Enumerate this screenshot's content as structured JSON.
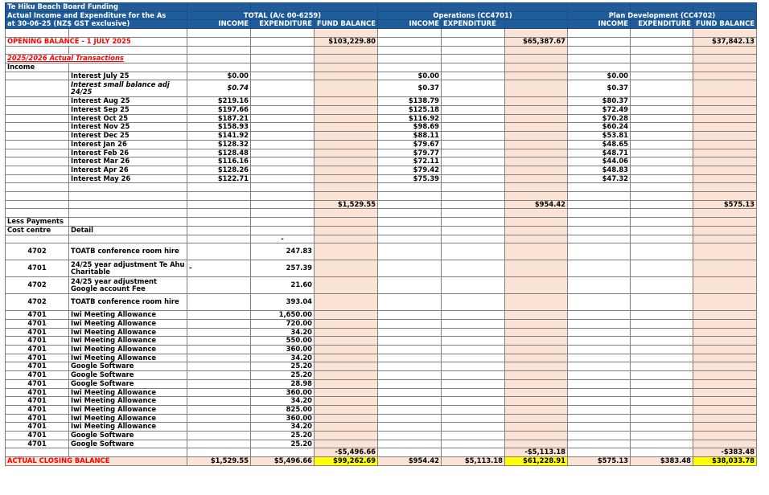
{
  "title": "Te Hiku Beach Board Funding",
  "header": {
    "line1": "Actual Income and Expenditure for the As",
    "line2": "at 30-06-25  (NZ$ GST exclusive)",
    "groups": [
      "TOTAL  (A/c 00-6259)",
      "Operations (CC4701)",
      "Plan Development (CC4702)"
    ],
    "cols": [
      "INCOME",
      "EXPENDITURE",
      "FUND BALANCE"
    ]
  },
  "opening": {
    "label": "OPENING BALANCE - 1 JULY 2025",
    "total": "$103,229.80",
    "ops": "$65,387.67",
    "plan": "$37,842.13"
  },
  "actual_label": "2025/2026 Actual Transactions",
  "income_label": "Income",
  "interest": [
    {
      "label": "Interest July 25",
      "total": "$0.00",
      "ops": "$0.00",
      "plan": "$0.00"
    },
    {
      "label": "Interest small balance adj 24/25",
      "total": "$0.74",
      "ops": "$0.37",
      "plan": "$0.37"
    },
    {
      "label": "Interest Aug 25",
      "total": "$219.16",
      "ops": "$138.79",
      "plan": "$80.37"
    },
    {
      "label": "Interest Sep 25",
      "total": "$197.66",
      "ops": "$125.18",
      "plan": "$72.49"
    },
    {
      "label": "Interest Oct 25",
      "total": "$187.21",
      "ops": "$116.92",
      "plan": "$70.28"
    },
    {
      "label": "Interest Nov 25",
      "total": "$158.93",
      "ops": "$98.69",
      "plan": "$60.24"
    },
    {
      "label": "Interest Dec 25",
      "total": "$141.92",
      "ops": "$88.11",
      "plan": "$53.81"
    },
    {
      "label": "Interest Jan 26",
      "total": "$128.32",
      "ops": "$79.67",
      "plan": "$48.65"
    },
    {
      "label": "Interest Feb 26",
      "total": "$128.48",
      "ops": "$79.77",
      "plan": "$48.71"
    },
    {
      "label": "Interest Mar 26",
      "total": "$116.16",
      "ops": "$72.11",
      "plan": "$44.06"
    },
    {
      "label": "Interest Apr 26",
      "total": "$128.26",
      "ops": "$79.42",
      "plan": "$48.83"
    },
    {
      "label": "Interest May 26",
      "total": "$122.71",
      "ops": "$75.39",
      "plan": "$47.32"
    }
  ],
  "income_totals": {
    "total": "$1,529.55",
    "ops": "$954.42",
    "plan": "$575.13"
  },
  "less_payments": "Less Payments",
  "cost_centre": "Cost centre",
  "detail": "Detail",
  "dash": "-",
  "payments": [
    {
      "cc": "4702",
      "detail": "TOATB conference room hire",
      "amt": "247.83",
      "pre": ""
    },
    {
      "cc": "4701",
      "detail": "24/25 year adjustment Te Ahu Charitable",
      "amt": "257.39",
      "pre": "-"
    },
    {
      "cc": "4702",
      "detail": "24/25 year adjustment Google account Fee",
      "amt": "21.60",
      "pre": ""
    },
    {
      "cc": "4702",
      "detail": "TOATB conference room hire",
      "amt": "393.04",
      "pre": ""
    },
    {
      "cc": "4701",
      "detail": "Iwi Meeting Allowance",
      "amt": "1,650.00",
      "pre": ""
    },
    {
      "cc": "4701",
      "detail": "Iwi Meeting Allowance",
      "amt": "720.00",
      "pre": ""
    },
    {
      "cc": "4701",
      "detail": "Iwi Meeting Allowance",
      "amt": "34.20",
      "pre": ""
    },
    {
      "cc": "4701",
      "detail": "Iwi Meeting Allowance",
      "amt": "550.00",
      "pre": ""
    },
    {
      "cc": "4701",
      "detail": "Iwi Meeting Allowance",
      "amt": "360.00",
      "pre": ""
    },
    {
      "cc": "4701",
      "detail": "Iwi Meeting Allowance",
      "amt": "34.20",
      "pre": ""
    },
    {
      "cc": "4701",
      "detail": "Google Software",
      "amt": "25.20",
      "pre": ""
    },
    {
      "cc": "4701",
      "detail": "Google Software",
      "amt": "25.20",
      "pre": ""
    },
    {
      "cc": "4701",
      "detail": "Google Software",
      "amt": "28.98",
      "pre": ""
    },
    {
      "cc": "4701",
      "detail": "Iwi Meeting Allowance",
      "amt": "360.00",
      "pre": ""
    },
    {
      "cc": "4701",
      "detail": "Iwi Meeting Allowance",
      "amt": "34.20",
      "pre": ""
    },
    {
      "cc": "4701",
      "detail": "Iwi Meeting Allowance",
      "amt": "825.00",
      "pre": ""
    },
    {
      "cc": "4701",
      "detail": "Iwi Meeting Allowance",
      "amt": "360.00",
      "pre": ""
    },
    {
      "cc": "4701",
      "detail": "Iwi Meeting Allowance",
      "amt": "34.20",
      "pre": ""
    },
    {
      "cc": "4701",
      "detail": "Google Software",
      "amt": "25.20",
      "pre": ""
    },
    {
      "cc": "4701",
      "detail": "Google Software",
      "amt": "25.20",
      "pre": ""
    }
  ],
  "payment_totals": {
    "total": "-$5,496.66",
    "ops": "-$5,113.18",
    "plan": "-$383.48"
  },
  "closing": {
    "label": "ACTUAL CLOSING BALANCE",
    "t_inc": "$1,529.55",
    "t_exp": "$5,496.66",
    "t_bal": "$99,262.69",
    "o_inc": "$954.42",
    "o_exp": "$5,113.18",
    "o_bal": "$61,228.91",
    "p_inc": "$575.13",
    "p_exp": "$383.48",
    "p_bal": "$38,033.78"
  }
}
